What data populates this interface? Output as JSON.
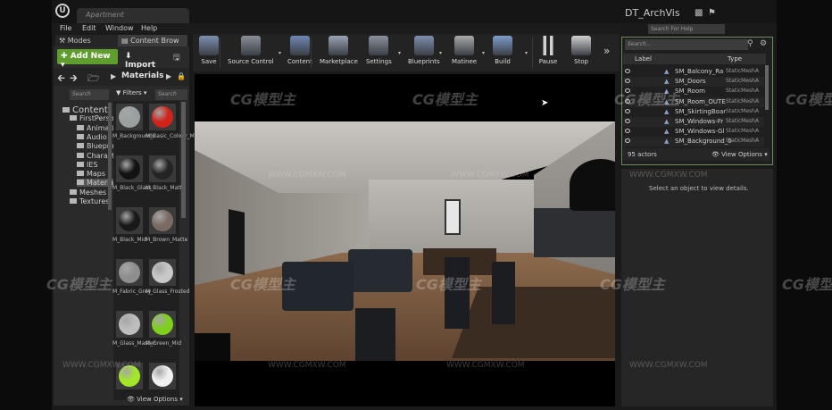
{
  "window": {
    "tab_title": "Apartment",
    "project_name": "DT_ArchVis",
    "help_search_placeholder": "Search For Help"
  },
  "menu": [
    "File",
    "Edit",
    "Window",
    "Help"
  ],
  "left_tabs": {
    "modes": "Modes",
    "content_browser": "Content Brow"
  },
  "content_browser": {
    "add_new": "Add New",
    "import": "Import",
    "path": "Materials",
    "tree_search_placeholder": "Search",
    "filters": "Filters",
    "asset_search_placeholder": "Search",
    "tree": [
      {
        "label": "Content",
        "level": 0
      },
      {
        "label": "FirstPerson",
        "level": 1
      },
      {
        "label": "Animations",
        "level": 2
      },
      {
        "label": "Audio",
        "level": 2
      },
      {
        "label": "Blueprints",
        "level": 2
      },
      {
        "label": "Character",
        "level": 2
      },
      {
        "label": "IES",
        "level": 2
      },
      {
        "label": "Maps",
        "level": 2
      },
      {
        "label": "Materials",
        "level": 2,
        "selected": true
      },
      {
        "label": "Meshes",
        "level": 1
      },
      {
        "label": "Textures",
        "level": 1
      }
    ],
    "assets": [
      {
        "label": "M_Backgrounds",
        "color": "#9aa0a0"
      },
      {
        "label": "M_Basic_Colour_Master",
        "color": "#d0231a"
      },
      {
        "label": "M_Black_Glass",
        "color": "#121212"
      },
      {
        "label": "M_Black_Matte",
        "color": "#242424"
      },
      {
        "label": "M_Black_Mid",
        "color": "#181818"
      },
      {
        "label": "M_Brown_Matte",
        "color": "#7a6a64"
      },
      {
        "label": "M_Fabric_Grey",
        "color": "#8e8e8e"
      },
      {
        "label": "M_Glass_Frosted",
        "color": "#c8c8c8"
      },
      {
        "label": "M_Glass_Master",
        "color": "#bdbdbd"
      },
      {
        "label": "M_Green_Mid",
        "color": "#7fcf1c"
      },
      {
        "label": "",
        "color": "#a4e62a"
      },
      {
        "label": "",
        "color": "#f0f0f0"
      }
    ],
    "view_options": "View Options"
  },
  "toolbar": [
    {
      "label": "Save",
      "icon": "save-icon",
      "color": "#7d8fb0"
    },
    {
      "label": "Source Control",
      "icon": "source-control-icon",
      "color": "#8a8f96"
    },
    {
      "label": "Content",
      "icon": "content-icon",
      "color": "#6f86b4"
    },
    {
      "label": "Marketplace",
      "icon": "marketplace-icon",
      "color": "#9aa3b3"
    },
    {
      "label": "Settings",
      "icon": "settings-icon",
      "color": "#8c929c"
    },
    {
      "label": "Blueprints",
      "icon": "blueprints-icon",
      "color": "#7e8fae"
    },
    {
      "label": "Matinee",
      "icon": "matinee-icon",
      "color": "#a9a9a9"
    },
    {
      "label": "Build",
      "icon": "build-icon",
      "color": "#7f9ccc"
    },
    {
      "label": "Pause",
      "icon": "pause-icon",
      "color": "#d0d0d0"
    },
    {
      "label": "Stop",
      "icon": "stop-icon",
      "color": "#d0d0d0"
    }
  ],
  "outliner": {
    "search_placeholder": "Search...",
    "col_label": "Label",
    "col_type": "Type",
    "rows": [
      {
        "label": "SM_Balcony_Ra",
        "type": "StaticMeshA"
      },
      {
        "label": "SM_Doors",
        "type": "StaticMeshA"
      },
      {
        "label": "SM_Room",
        "type": "StaticMeshA"
      },
      {
        "label": "SM_Room_OUTE",
        "type": "StaticMeshA"
      },
      {
        "label": "SM_SkirtingBoar",
        "type": "StaticMeshA"
      },
      {
        "label": "SM_Windows-Fr",
        "type": "StaticMeshA"
      },
      {
        "label": "SM_Windows-Gl",
        "type": "StaticMeshA"
      },
      {
        "label": "SM_Background_0",
        "type": "StaticMeshA"
      }
    ],
    "actor_count": "95 actors",
    "view_options": "View Options"
  },
  "details": {
    "empty_text": "Select an object to view details."
  },
  "watermarks": {
    "brand": "CG模型主",
    "url": "WWW.CGMXW.COM"
  }
}
